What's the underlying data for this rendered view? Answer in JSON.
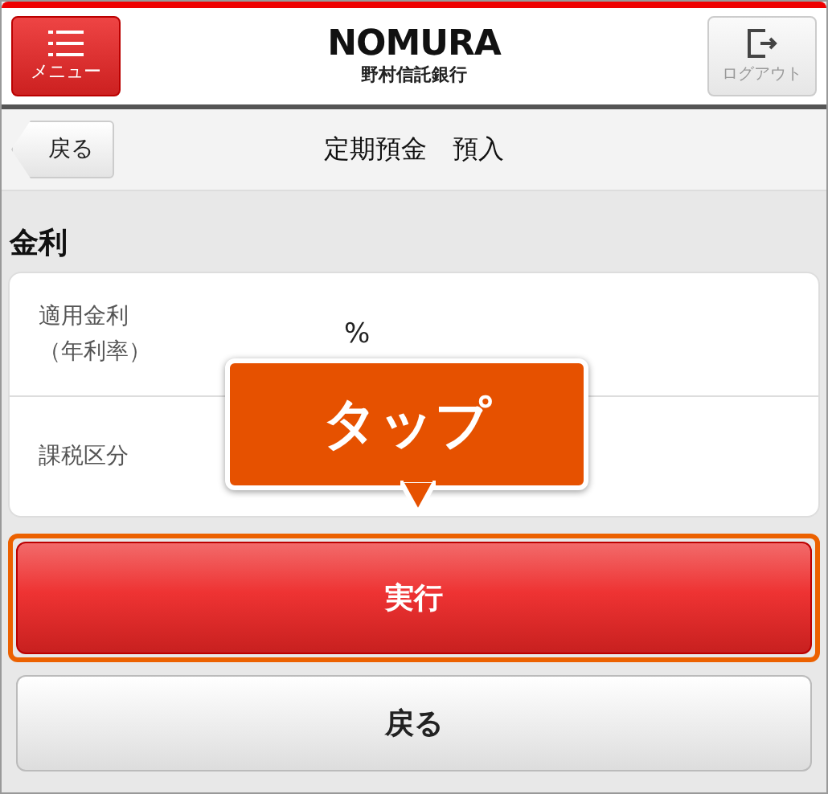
{
  "header": {
    "menu_label": "メニュー",
    "logo": "NOMURA",
    "logo_sub": "野村信託銀行",
    "logout_label": "ログアウト"
  },
  "subheader": {
    "back_label": "戻る",
    "title": "定期預金　預入"
  },
  "section": {
    "title": "金利"
  },
  "rows": [
    {
      "label": [
        "適用金利",
        "（年利率）"
      ],
      "value": "%"
    },
    {
      "label": [
        "課税区分"
      ],
      "value": ""
    }
  ],
  "tooltip": {
    "text": "タップ"
  },
  "buttons": [
    {
      "kind": "primary",
      "label": "実行",
      "highlighted": true
    },
    {
      "kind": "secondary",
      "label": "戻る",
      "highlighted": false
    }
  ]
}
